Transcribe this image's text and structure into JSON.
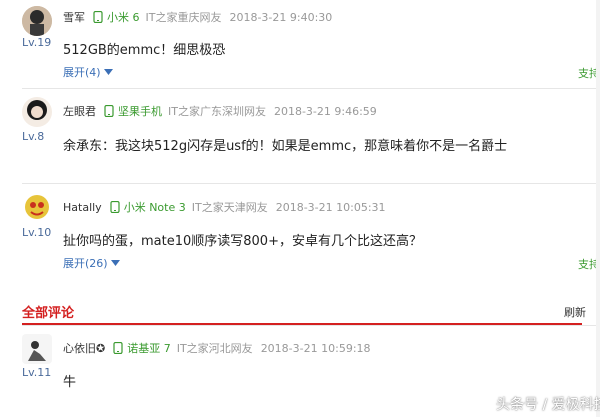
{
  "comments": [
    {
      "user": "雪军",
      "level": "Lv.19",
      "device": "小米 6",
      "location": "IT之家重庆网友",
      "time": "2018-3-21 9:40:30",
      "content": "512GB的emmc！细思极恐",
      "expand": "展开(4)",
      "support": "支持",
      "avatar_colors": [
        "#2b2b2b",
        "#d8c6b0"
      ]
    },
    {
      "user": "左眼君",
      "level": "Lv.8",
      "device": "坚果手机",
      "location": "IT之家广东深圳网友",
      "time": "2018-3-21 9:46:59",
      "content": "余承东：我这块512g闪存是usf的！如果是emmc，那意味着你不是一名爵士",
      "support": "",
      "avatar_colors": [
        "#1a1a1a",
        "#f0dccd"
      ]
    },
    {
      "user": "Hatally",
      "level": "Lv.10",
      "device": "小米 Note 3",
      "location": "IT之家天津网友",
      "time": "2018-3-21 10:05:31",
      "content": "扯你吗的蛋，mate10顺序读写800+，安卓有几个比这还高？",
      "expand": "展开(26)",
      "support": "支持",
      "avatar_colors": [
        "#e7c43a",
        "#c8301e"
      ]
    }
  ],
  "section": {
    "title": "全部评论",
    "refresh": "刷新"
  },
  "latest": {
    "user": "心依旧✪",
    "level": "Lv.11",
    "device": "诺基亚 7",
    "location": "IT之家河北网友",
    "time": "2018-3-21 10:59:18",
    "content": "牛",
    "avatar_colors": [
      "#ffffff",
      "#333333"
    ]
  },
  "watermark": "头条号 / 爱极科技",
  "colors": {
    "accent_red": "#d42020",
    "device_green": "#3a9a2f",
    "link_blue": "#3b6fb6"
  }
}
